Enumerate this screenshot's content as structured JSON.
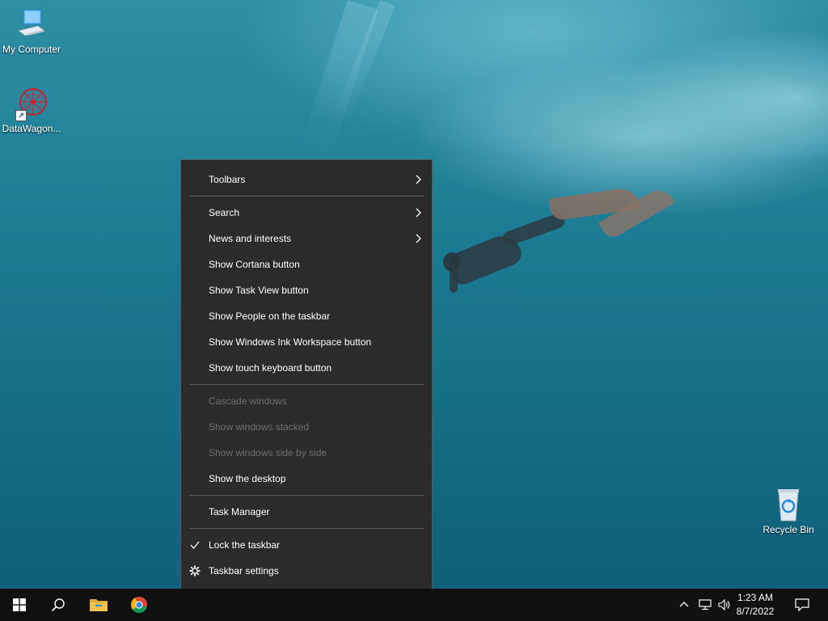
{
  "desktop": {
    "icons": [
      {
        "label": "My Computer"
      },
      {
        "label": "DataWagon..."
      },
      {
        "label": "Recycle Bin"
      }
    ]
  },
  "context_menu": {
    "items": [
      {
        "label": "Toolbars",
        "submenu": true,
        "enabled": true
      },
      {
        "label": "Search",
        "submenu": true,
        "enabled": true
      },
      {
        "label": "News and interests",
        "submenu": true,
        "enabled": true
      },
      {
        "label": "Show Cortana button",
        "enabled": true
      },
      {
        "label": "Show Task View button",
        "enabled": true
      },
      {
        "label": "Show People on the taskbar",
        "enabled": true
      },
      {
        "label": "Show Windows Ink Workspace button",
        "enabled": true
      },
      {
        "label": "Show touch keyboard button",
        "enabled": true
      },
      {
        "label": "Cascade windows",
        "enabled": false
      },
      {
        "label": "Show windows stacked",
        "enabled": false
      },
      {
        "label": "Show windows side by side",
        "enabled": false
      },
      {
        "label": "Show the desktop",
        "enabled": true
      },
      {
        "label": "Task Manager",
        "enabled": true
      },
      {
        "label": "Lock the taskbar",
        "enabled": true,
        "checked": true,
        "icon": "checkmark-icon"
      },
      {
        "label": "Taskbar settings",
        "enabled": true,
        "icon": "gear-icon"
      }
    ]
  },
  "taskbar": {
    "buttons": [
      "windows-start-icon",
      "search-icon",
      "file-explorer-icon",
      "chrome-icon"
    ],
    "tray_icons": [
      "chevron-up-icon",
      "network-icon",
      "volume-icon"
    ],
    "clock": {
      "time": "1:23 AM",
      "date": "8/7/2022"
    },
    "notification_icon": "action-center-icon"
  },
  "colors": {
    "menu_bg": "#2b2b2b",
    "menu_disabled_text": "#6d6d6d",
    "taskbar_bg": "#101010",
    "windows_logo": "#ffffff",
    "explorer_folder": "#f0c24b"
  }
}
